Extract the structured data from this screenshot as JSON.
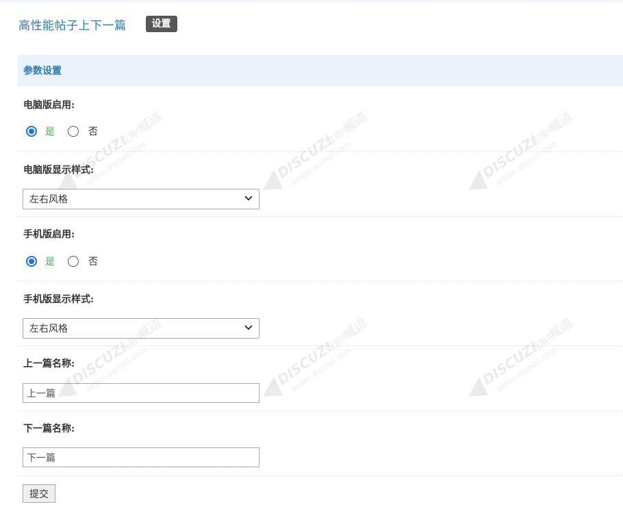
{
  "header": {
    "plugin_title": "高性能帖子上下一篇",
    "settings_tab": "设置"
  },
  "section": {
    "title": "参数设置"
  },
  "form": {
    "pc_enable": {
      "label": "电脑版启用:",
      "yes": "是",
      "no": "否",
      "selected": "是"
    },
    "pc_style": {
      "label": "电脑版显示样式:",
      "value": "左右风格"
    },
    "mobile_enable": {
      "label": "手机版启用:",
      "yes": "是",
      "no": "否",
      "selected": "是"
    },
    "mobile_style": {
      "label": "手机版显示样式:",
      "value": "左右风格"
    },
    "prev_name": {
      "label": "上一篇名称:",
      "value": "上一篇"
    },
    "next_name": {
      "label": "下一篇名称:",
      "value": "下一篇"
    },
    "submit_label": "提交"
  },
  "watermark": {
    "brand": "DISCUZ!",
    "center": "应用中心",
    "site": "addon.dismall.com",
    "mark": "贰道"
  },
  "colors": {
    "accent": "#2b7cad",
    "tab_bg": "#575757",
    "section_bg": "#eaf3fb",
    "radio_selected": "#1a73e8",
    "yes_text": "#3cb34d"
  }
}
